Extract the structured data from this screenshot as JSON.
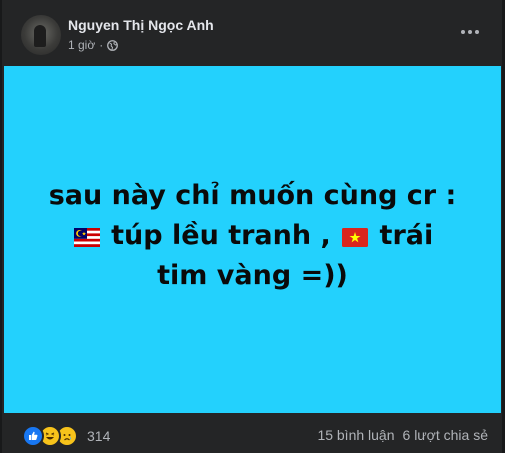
{
  "post": {
    "author": "Nguyen Thị Ngọc Anh",
    "time": "1 giờ",
    "privacy_icon": "globe-icon",
    "text_before_flag1": "sau này chỉ muốn cùng cr :",
    "flag1": "malaysia-flag",
    "text_between_flags": " túp lều tranh , ",
    "flag2": "vietnam-flag",
    "text_after_flag2": " trái tim vàng =))",
    "background_color": "#23d1fd"
  },
  "footer": {
    "reaction_icons": [
      "like-icon",
      "haha-icon",
      "sad-icon"
    ],
    "reaction_count": "314",
    "comments": "15 bình luận",
    "shares": "6 lượt chia sẻ"
  }
}
